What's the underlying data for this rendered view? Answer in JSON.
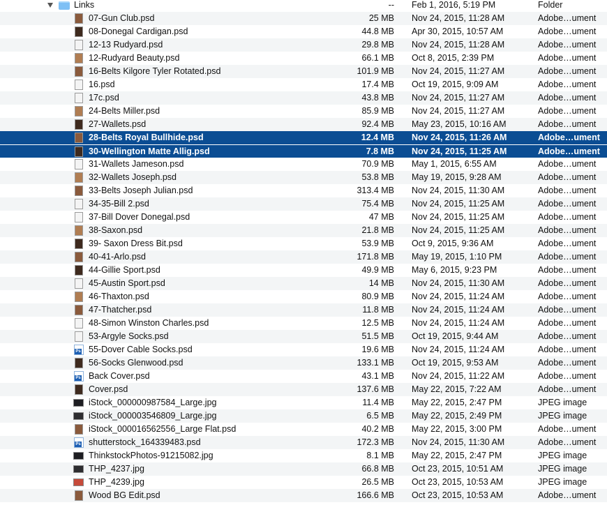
{
  "folder": {
    "name": "Links",
    "size": "--",
    "date": "Feb 1, 2016, 5:19 PM",
    "kind": "Folder"
  },
  "files": [
    {
      "name": "07-Gun Club.psd",
      "size": "25 MB",
      "date": "Nov 24, 2015, 11:28 AM",
      "kind": "Adobe…ument",
      "icon": "psd-thumbnail-icon"
    },
    {
      "name": "08-Donegal Cardigan.psd",
      "size": "44.8 MB",
      "date": "Apr 30, 2015, 10:57 AM",
      "kind": "Adobe…ument",
      "icon": "psd-thumbnail-icon"
    },
    {
      "name": "12-13 Rudyard.psd",
      "size": "29.8 MB",
      "date": "Nov 24, 2015, 11:28 AM",
      "kind": "Adobe…ument",
      "icon": "psd-thumbnail-icon"
    },
    {
      "name": "12-Rudyard Beauty.psd",
      "size": "66.1 MB",
      "date": "Oct 8, 2015, 2:39 PM",
      "kind": "Adobe…ument",
      "icon": "psd-thumbnail-icon"
    },
    {
      "name": "16-Belts Kilgore Tyler Rotated.psd",
      "size": "101.9 MB",
      "date": "Nov 24, 2015, 11:27 AM",
      "kind": "Adobe…ument",
      "icon": "psd-thumbnail-icon"
    },
    {
      "name": "16.psd",
      "size": "17.4 MB",
      "date": "Oct 19, 2015, 9:09 AM",
      "kind": "Adobe…ument",
      "icon": "psd-thumbnail-icon"
    },
    {
      "name": "17c.psd",
      "size": "43.8 MB",
      "date": "Nov 24, 2015, 11:27 AM",
      "kind": "Adobe…ument",
      "icon": "psd-thumbnail-icon"
    },
    {
      "name": "24-Belts Miller.psd",
      "size": "85.9 MB",
      "date": "Nov 24, 2015, 11:27 AM",
      "kind": "Adobe…ument",
      "icon": "psd-thumbnail-icon"
    },
    {
      "name": "27-Wallets.psd",
      "size": "92.4 MB",
      "date": "May 23, 2015, 10:16 AM",
      "kind": "Adobe…ument",
      "icon": "psd-thumbnail-icon"
    },
    {
      "name": "28-Belts Royal Bullhide.psd",
      "size": "12.4 MB",
      "date": "Nov 24, 2015, 11:26 AM",
      "kind": "Adobe…ument",
      "icon": "psd-thumbnail-icon",
      "selected": true
    },
    {
      "name": "30-Wellington Matte Allig.psd",
      "size": "7.8 MB",
      "date": "Nov 24, 2015, 11:25 AM",
      "kind": "Adobe…ument",
      "icon": "psd-thumbnail-icon",
      "selected": true
    },
    {
      "name": "31-Wallets Jameson.psd",
      "size": "70.9 MB",
      "date": "May 1, 2015, 6:55 AM",
      "kind": "Adobe…ument",
      "icon": "psd-thumbnail-icon"
    },
    {
      "name": "32-Wallets Joseph.psd",
      "size": "53.8 MB",
      "date": "May 19, 2015, 9:28 AM",
      "kind": "Adobe…ument",
      "icon": "psd-thumbnail-icon"
    },
    {
      "name": "33-Belts Joseph Julian.psd",
      "size": "313.4 MB",
      "date": "Nov 24, 2015, 11:30 AM",
      "kind": "Adobe…ument",
      "icon": "psd-thumbnail-icon"
    },
    {
      "name": "34-35-Bill 2.psd",
      "size": "75.4 MB",
      "date": "Nov 24, 2015, 11:25 AM",
      "kind": "Adobe…ument",
      "icon": "psd-thumbnail-icon"
    },
    {
      "name": "37-Bill Dover Donegal.psd",
      "size": "47 MB",
      "date": "Nov 24, 2015, 11:25 AM",
      "kind": "Adobe…ument",
      "icon": "psd-thumbnail-icon"
    },
    {
      "name": "38-Saxon.psd",
      "size": "21.8 MB",
      "date": "Nov 24, 2015, 11:25 AM",
      "kind": "Adobe…ument",
      "icon": "psd-thumbnail-icon"
    },
    {
      "name": "39- Saxon Dress Bit.psd",
      "size": "53.9 MB",
      "date": "Oct 9, 2015, 9:36 AM",
      "kind": "Adobe…ument",
      "icon": "psd-thumbnail-icon"
    },
    {
      "name": "40-41-Arlo.psd",
      "size": "171.8 MB",
      "date": "May 19, 2015, 1:10 PM",
      "kind": "Adobe…ument",
      "icon": "psd-thumbnail-icon"
    },
    {
      "name": "44-Gillie Sport.psd",
      "size": "49.9 MB",
      "date": "May 6, 2015, 9:23 PM",
      "kind": "Adobe…ument",
      "icon": "psd-thumbnail-icon"
    },
    {
      "name": "45-Austin Sport.psd",
      "size": "14 MB",
      "date": "Nov 24, 2015, 11:30 AM",
      "kind": "Adobe…ument",
      "icon": "psd-thumbnail-icon"
    },
    {
      "name": "46-Thaxton.psd",
      "size": "80.9 MB",
      "date": "Nov 24, 2015, 11:24 AM",
      "kind": "Adobe…ument",
      "icon": "psd-thumbnail-icon"
    },
    {
      "name": "47-Thatcher.psd",
      "size": "11.8 MB",
      "date": "Nov 24, 2015, 11:24 AM",
      "kind": "Adobe…ument",
      "icon": "psd-thumbnail-icon"
    },
    {
      "name": "48-Simon Winston Charles.psd",
      "size": "12.5 MB",
      "date": "Nov 24, 2015, 11:24 AM",
      "kind": "Adobe…ument",
      "icon": "psd-thumbnail-icon"
    },
    {
      "name": "53-Argyle Socks.psd",
      "size": "51.5 MB",
      "date": "Oct 19, 2015, 9:44 AM",
      "kind": "Adobe…ument",
      "icon": "psd-thumbnail-icon"
    },
    {
      "name": "55-Dover Cable Socks.psd",
      "size": "19.6 MB",
      "date": "Nov 24, 2015, 11:24 AM",
      "kind": "Adobe…ument",
      "icon": "photoshop-document-icon"
    },
    {
      "name": "56-Socks Glenwood.psd",
      "size": "133.1 MB",
      "date": "Oct 19, 2015, 9:53 AM",
      "kind": "Adobe…ument",
      "icon": "psd-thumbnail-icon"
    },
    {
      "name": "Back Cover.psd",
      "size": "43.1 MB",
      "date": "Nov 24, 2015, 11:22 AM",
      "kind": "Adobe…ument",
      "icon": "photoshop-document-icon"
    },
    {
      "name": "Cover.psd",
      "size": "137.6 MB",
      "date": "May 22, 2015, 7:22 AM",
      "kind": "Adobe…ument",
      "icon": "psd-thumbnail-icon"
    },
    {
      "name": "iStock_000000987584_Large.jpg",
      "size": "11.4 MB",
      "date": "May 22, 2015, 2:47 PM",
      "kind": "JPEG image",
      "icon": "jpeg-thumbnail-icon"
    },
    {
      "name": "iStock_000003546809_Large.jpg",
      "size": "6.5 MB",
      "date": "May 22, 2015, 2:49 PM",
      "kind": "JPEG image",
      "icon": "jpeg-thumbnail-icon"
    },
    {
      "name": "iStock_000016562556_Large Flat.psd",
      "size": "40.2 MB",
      "date": "May 22, 2015, 3:00 PM",
      "kind": "Adobe…ument",
      "icon": "psd-thumbnail-icon"
    },
    {
      "name": "shutterstock_164339483.psd",
      "size": "172.3 MB",
      "date": "Nov 24, 2015, 11:30 AM",
      "kind": "Adobe…ument",
      "icon": "photoshop-document-icon"
    },
    {
      "name": "ThinkstockPhotos-91215082.jpg",
      "size": "8.1 MB",
      "date": "May 22, 2015, 2:47 PM",
      "kind": "JPEG image",
      "icon": "jpeg-thumbnail-icon"
    },
    {
      "name": "THP_4237.jpg",
      "size": "66.8 MB",
      "date": "Oct 23, 2015, 10:51 AM",
      "kind": "JPEG image",
      "icon": "jpeg-thumbnail-icon"
    },
    {
      "name": "THP_4239.jpg",
      "size": "26.5 MB",
      "date": "Oct 23, 2015, 10:53 AM",
      "kind": "JPEG image",
      "icon": "jpeg-thumbnail-icon"
    },
    {
      "name": "Wood BG Edit.psd",
      "size": "166.6 MB",
      "date": "Oct 23, 2015, 10:53 AM",
      "kind": "Adobe…ument",
      "icon": "psd-thumbnail-icon"
    }
  ],
  "colors": {
    "selection": "#0b4d93",
    "stripe": "#f3f5f6",
    "folder": "#7ec0f5"
  }
}
